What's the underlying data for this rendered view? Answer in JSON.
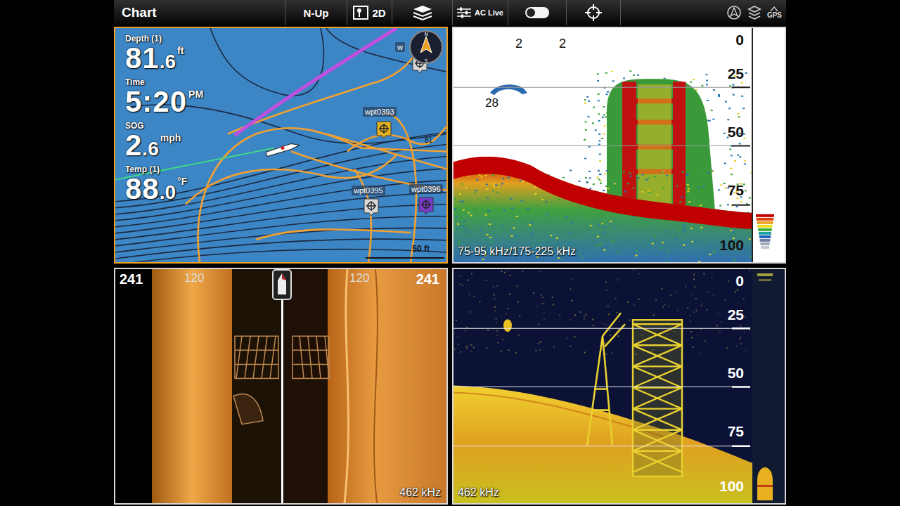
{
  "topbar": {
    "title": "Chart",
    "orientation": "N-Up",
    "view": "2D",
    "ac_live": "AC Live",
    "toggle_on": false,
    "gps": "GPS"
  },
  "chart": {
    "readouts": [
      {
        "label": "Depth (1)",
        "value": "81",
        "decimal": ".6",
        "unit": "ft"
      },
      {
        "label": "Time",
        "value": "5:20",
        "decimal": "",
        "unit": "PM"
      },
      {
        "label": "SOG",
        "value": "2",
        "decimal": ".6",
        "unit": "mph"
      },
      {
        "label": "Temp (1)",
        "value": "88",
        "decimal": ".0",
        "unit": "°F"
      }
    ],
    "waypoints": [
      {
        "label": "w",
        "color": "#d8d8d8"
      },
      {
        "label": "wpt0393",
        "color": "#e0b020"
      },
      {
        "label": "wpt0395",
        "color": "#d8d8d8"
      },
      {
        "label": "wpt0396",
        "color": "#7a3cc8"
      }
    ],
    "contour_label": "81",
    "compass": {
      "north": "N",
      "south": "S"
    },
    "scale": "50 ft"
  },
  "sonar": {
    "marks": [
      "2",
      "2"
    ],
    "fish_label": "28",
    "depth_ticks": [
      "0",
      "25",
      "50",
      "75",
      "100"
    ],
    "frequency": "75-95 kHz/175-225 kHz"
  },
  "side_imaging": {
    "ranges": [
      "241",
      "120",
      "120",
      "241"
    ],
    "frequency": "462 kHz"
  },
  "down_imaging": {
    "depth_ticks": [
      "0",
      "25",
      "50",
      "75",
      "100"
    ],
    "frequency": "462 kHz"
  }
}
